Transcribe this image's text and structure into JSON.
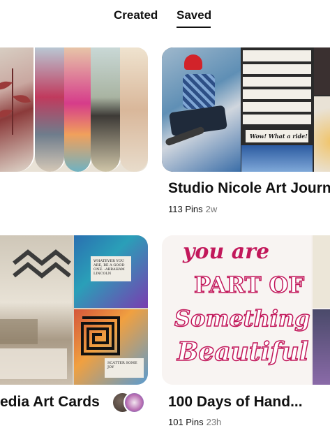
{
  "tabs": {
    "created": "Created",
    "saved": "Saved",
    "active": "saved"
  },
  "boards": [
    {
      "title": "",
      "pins": "",
      "updated": ""
    },
    {
      "title": "Studio Nicole Art Journ",
      "pins": "113 Pins",
      "updated": "2w",
      "cover_text": {
        "line1": "Wow! What a ride!"
      }
    },
    {
      "title": "edia Art Cards",
      "pins": "",
      "updated": "",
      "cover_text": {
        "card1": "WHATEVER YOU ARE, BE A GOOD ONE. -ABRAHAM LINCOLN",
        "card2": "SCATTER SOME JOY"
      }
    },
    {
      "title": "100 Days of Hand...",
      "pins": "101 Pins",
      "updated": "23h",
      "cover_text": {
        "l1": "you are",
        "l2": "PART OF",
        "l3": "Something",
        "l4": "Beautiful"
      }
    }
  ],
  "colors": {
    "text": "#111111",
    "muted": "#767676",
    "pink": "#c2185b"
  },
  "icons": {
    "collaborators": "avatar-stack"
  }
}
